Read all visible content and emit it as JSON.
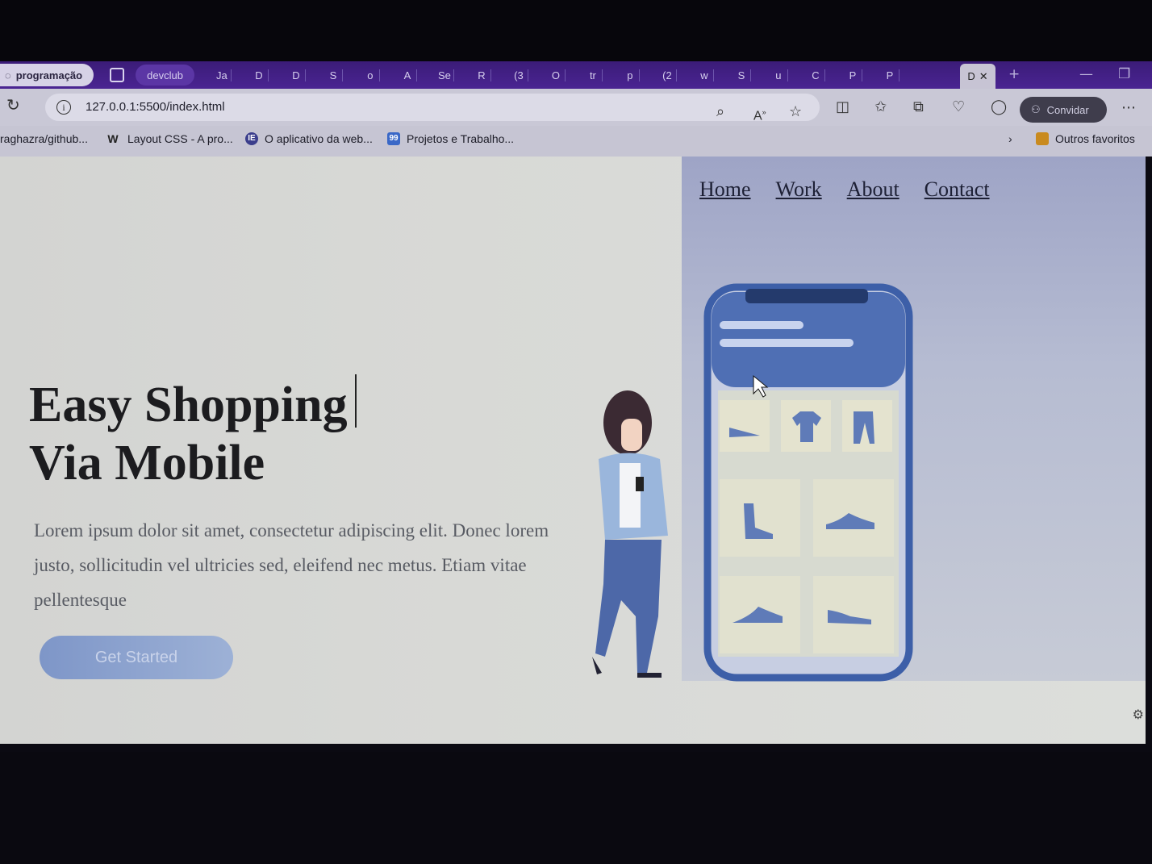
{
  "browser": {
    "tabs": {
      "pinned": "programação",
      "group": "devclub",
      "mini": [
        "Ja",
        "D",
        "D",
        "S",
        "o",
        "A",
        "Se",
        "R",
        "(3",
        "O",
        "tr",
        "p",
        "(2",
        "w",
        "S",
        "u",
        "C",
        "P",
        "P"
      ],
      "active": "D"
    },
    "url": "127.0.0.1:5500/index.html",
    "invite_label": "Convidar",
    "bookmarks": [
      {
        "label": "raghazra/github...",
        "icon": "github-icon"
      },
      {
        "label": "Layout CSS - A pro...",
        "icon": "w-icon"
      },
      {
        "label": "O aplicativo da web...",
        "icon": "ie-icon"
      },
      {
        "label": "Projetos e Trabalho...",
        "icon": "99-icon"
      }
    ],
    "other_favorites": "Outros favoritos"
  },
  "site": {
    "nav": [
      "Home",
      "Work",
      "About",
      "Contact"
    ],
    "title_line1": "Easy Shopping",
    "title_line2": "Via Mobile",
    "paragraph": "Lorem ipsum dolor sit amet, consectetur adipiscing elit. Donec lorem justo, sollicitudin vel ultricies sed, eleifend nec metus. Etiam vitae pellentesque",
    "cta": "Get Started"
  },
  "colors": {
    "tab_strip": "#4a2492",
    "panel": "#b6bcd2",
    "phone_frame": "#3d5fa8",
    "button": "#8ea4cf"
  }
}
